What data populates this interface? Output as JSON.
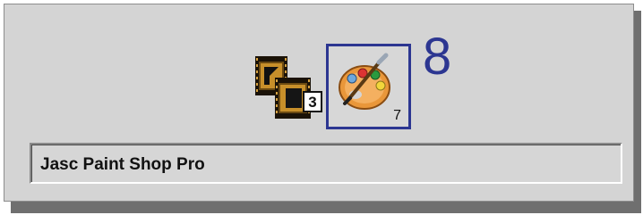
{
  "step_number": "8",
  "task_switcher": {
    "window_count": "3",
    "selected_app_count": "7"
  },
  "status_field": {
    "app_name": "Jasc Paint Shop Pro"
  },
  "colors": {
    "selection_border": "#2c3691",
    "step_number": "#2c3691",
    "panel": "#d4d4d4"
  },
  "icons": [
    "film-stack-icon",
    "paint-palette-icon"
  ]
}
